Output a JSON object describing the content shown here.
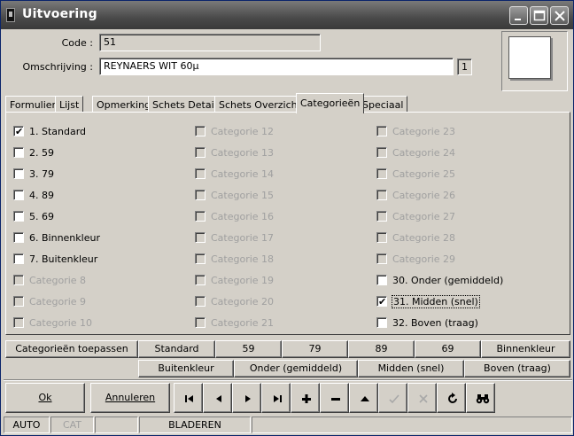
{
  "window": {
    "title": "Uitvoering"
  },
  "header": {
    "code_label": "Code :",
    "code_value": "51",
    "omschrijving_label": "Omschrijving :",
    "omschrijving_value": "REYNAERS WIT 60µ",
    "counter": "1"
  },
  "tabs": [
    "Formulier",
    "Lijst",
    "Opmerking",
    "Schets Detail",
    "Schets Overzicht",
    "Categorieën",
    "Speciaal"
  ],
  "active_tab": "Categorieën",
  "categories": {
    "col1": [
      {
        "label": "1. Standard",
        "checked": true,
        "enabled": true
      },
      {
        "label": "2. 59",
        "checked": false,
        "enabled": true
      },
      {
        "label": "3. 79",
        "checked": false,
        "enabled": true
      },
      {
        "label": "4. 89",
        "checked": false,
        "enabled": true
      },
      {
        "label": "5. 69",
        "checked": false,
        "enabled": true
      },
      {
        "label": "6. Binnenkleur",
        "checked": false,
        "enabled": true
      },
      {
        "label": "7. Buitenkleur",
        "checked": false,
        "enabled": true
      },
      {
        "label": "Categorie 8",
        "checked": false,
        "enabled": false
      },
      {
        "label": "Categorie 9",
        "checked": false,
        "enabled": false
      },
      {
        "label": "Categorie 10",
        "checked": false,
        "enabled": false
      }
    ],
    "col2": [
      {
        "label": "Categorie 12",
        "checked": false,
        "enabled": false
      },
      {
        "label": "Categorie 13",
        "checked": false,
        "enabled": false
      },
      {
        "label": "Categorie 14",
        "checked": false,
        "enabled": false
      },
      {
        "label": "Categorie 15",
        "checked": false,
        "enabled": false
      },
      {
        "label": "Categorie 16",
        "checked": false,
        "enabled": false
      },
      {
        "label": "Categorie 17",
        "checked": false,
        "enabled": false
      },
      {
        "label": "Categorie 18",
        "checked": false,
        "enabled": false
      },
      {
        "label": "Categorie 19",
        "checked": false,
        "enabled": false
      },
      {
        "label": "Categorie 20",
        "checked": false,
        "enabled": false
      },
      {
        "label": "Categorie 21",
        "checked": false,
        "enabled": false
      }
    ],
    "col3": [
      {
        "label": "Categorie 23",
        "checked": false,
        "enabled": false
      },
      {
        "label": "Categorie 24",
        "checked": false,
        "enabled": false
      },
      {
        "label": "Categorie 25",
        "checked": false,
        "enabled": false
      },
      {
        "label": "Categorie 26",
        "checked": false,
        "enabled": false
      },
      {
        "label": "Categorie 27",
        "checked": false,
        "enabled": false
      },
      {
        "label": "Categorie 28",
        "checked": false,
        "enabled": false
      },
      {
        "label": "Categorie 29",
        "checked": false,
        "enabled": false
      },
      {
        "label": "30. Onder (gemiddeld)",
        "checked": false,
        "enabled": true
      },
      {
        "label": "31. Midden (snel)",
        "checked": true,
        "enabled": true
      },
      {
        "label": "32. Boven (traag)",
        "checked": false,
        "enabled": true
      }
    ]
  },
  "apply_row1": [
    "Categorieën toepassen",
    "Standard",
    "59",
    "79",
    "89",
    "69",
    "Binnenkleur"
  ],
  "apply_row2": [
    "Buitenkleur",
    "Onder (gemiddeld)",
    "Midden (snel)",
    "Boven (traag)"
  ],
  "buttons": {
    "ok": "Ok",
    "annuleren": "Annuleren"
  },
  "nav_icons": [
    "first-record-icon",
    "prev-record-icon",
    "next-record-icon",
    "last-record-icon",
    "add-icon",
    "delete-icon",
    "up-icon",
    "confirm-icon",
    "cancel-edit-icon",
    "refresh-icon",
    "find-binoculars-icon"
  ],
  "status": {
    "mode": "AUTO",
    "cat": "CAT",
    "empty": "",
    "state": "BLADEREN"
  }
}
